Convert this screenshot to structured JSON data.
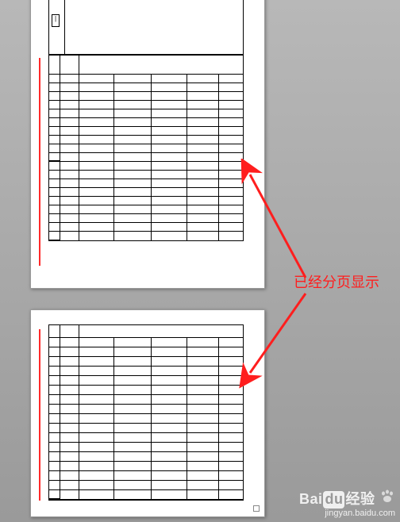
{
  "annotation": {
    "text": "已经分页显示"
  },
  "pages": {
    "page1": {
      "top_mark": "|",
      "grid": {
        "left_spans": [
          10,
          9
        ],
        "rows": 19,
        "cols": [
          45,
          47,
          45,
          41,
          30
        ]
      }
    },
    "page2": {
      "grid": {
        "rows": 17,
        "cols": [
          45,
          47,
          45,
          41,
          30
        ]
      }
    }
  },
  "gutter_marks": {
    "page1_dashes": [
      20
    ],
    "page2_dashes": [
      624
    ],
    "page2_tick": [
      644
    ]
  },
  "watermark": {
    "brand_left": "Bai",
    "brand_mid": "du",
    "brand_right": "经验",
    "url": "jingyan.baidu.com"
  }
}
